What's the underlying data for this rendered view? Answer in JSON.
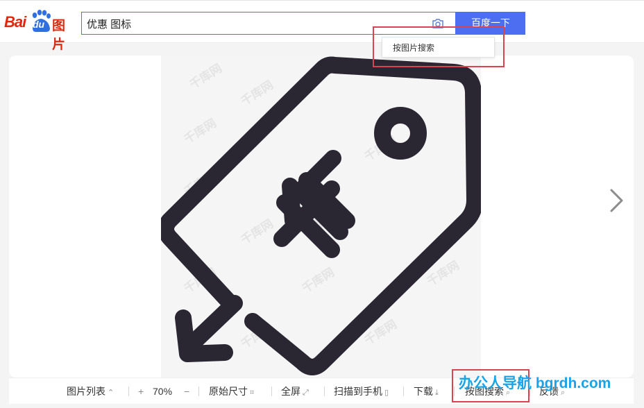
{
  "header": {
    "logo": {
      "bai": "Bai",
      "du": "du",
      "tupian": "图片"
    },
    "search_query": "优惠 图标",
    "search_button": "百度一下",
    "camera_icon": "camera-icon"
  },
  "dropdown": {
    "label": "按图片搜索"
  },
  "viewer": {
    "watermark_text": "千库网",
    "next_icon": "chevron-right-icon"
  },
  "toolbar": {
    "image_list": "图片列表",
    "image_list_icon": "⌃",
    "zoom_in": "+",
    "zoom_level": "70%",
    "zoom_out": "−",
    "original_size": "原始尺寸",
    "original_size_icon": "⌗",
    "fullscreen": "全屏",
    "fullscreen_icon": "⤢",
    "scan_to_phone": "扫描到手机",
    "scan_to_phone_icon": "▯",
    "download": "下载",
    "download_icon": "⤓",
    "search_by_image": "按图搜索",
    "search_by_image_icon": "⌕",
    "feedback": "反馈",
    "feedback_icon": "⌕"
  },
  "site_watermark": "办公人导航 bgrdh.com",
  "colors": {
    "brand_blue": "#4e6ef2",
    "highlight_red": "#d9444e",
    "icon_dark": "#2a2733"
  }
}
